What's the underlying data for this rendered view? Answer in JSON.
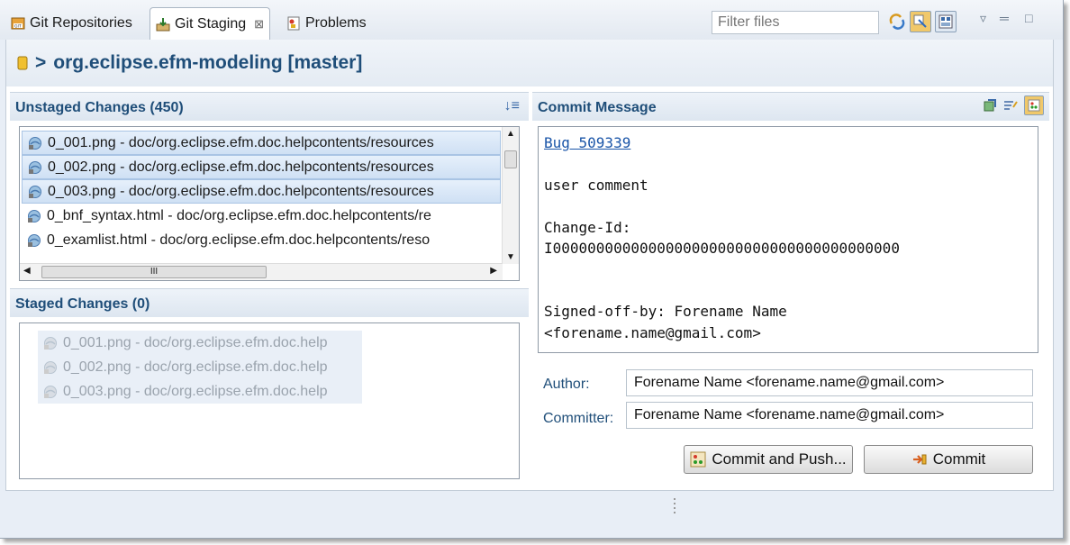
{
  "tabs": [
    {
      "label": "Git Repositories",
      "icon": "git-repositories-icon"
    },
    {
      "label": "Git Staging",
      "icon": "git-staging-icon",
      "active": true,
      "close": "⊠"
    },
    {
      "label": "Problems",
      "icon": "problems-icon"
    }
  ],
  "toolbar": {
    "filter_placeholder": "Filter files",
    "minimize": "▽",
    "restore": "▭",
    "maximize": "□",
    "menu": "▿"
  },
  "repository": {
    "prefix": ">",
    "title": "org.eclipse.efm-modeling [master]"
  },
  "unstaged": {
    "title": "Unstaged Changes (450)",
    "items": [
      {
        "text": "0_001.png - doc/org.eclipse.efm.doc.helpcontents/resources",
        "selected": true
      },
      {
        "text": "0_002.png - doc/org.eclipse.efm.doc.helpcontents/resources",
        "selected": true
      },
      {
        "text": "0_003.png - doc/org.eclipse.efm.doc.helpcontents/resources",
        "selected": true
      },
      {
        "text": "0_bnf_syntax.html - doc/org.eclipse.efm.doc.helpcontents/re",
        "selected": false
      },
      {
        "text": "0_examlist.html - doc/org.eclipse.efm.doc.helpcontents/reso",
        "selected": false
      }
    ],
    "hscroll_label": "III"
  },
  "staged": {
    "title": "Staged Changes (0)",
    "items": [
      {
        "text": "0_001.png - doc/org.eclipse.efm.doc.help"
      },
      {
        "text": "0_002.png - doc/org.eclipse.efm.doc.help"
      },
      {
        "text": "0_003.png - doc/org.eclipse.efm.doc.help"
      }
    ]
  },
  "commit": {
    "title": "Commit Message",
    "lines": [
      {
        "text": "Bug 509339",
        "link": true
      },
      {
        "text": ""
      },
      {
        "text": "user comment"
      },
      {
        "text": ""
      },
      {
        "text": "Change-Id:"
      },
      {
        "text": "I0000000000000000000000000000000000000000"
      },
      {
        "text": ""
      },
      {
        "text": ""
      },
      {
        "text": "Signed-off-by: Forename Name"
      },
      {
        "text": "<forename.name@gmail.com>"
      }
    ],
    "author_label": "Author:",
    "author_value": "Forename Name <forename.name@gmail.com>",
    "committer_label": "Committer:",
    "committer_value": "Forename Name <forename.name@gmail.com>",
    "commit_and_push_label": "Commit and Push...",
    "commit_label": "Commit"
  },
  "colors": {
    "accent": "#1f4e79",
    "selection": "#cfe0f4",
    "link": "#1a55a8"
  }
}
